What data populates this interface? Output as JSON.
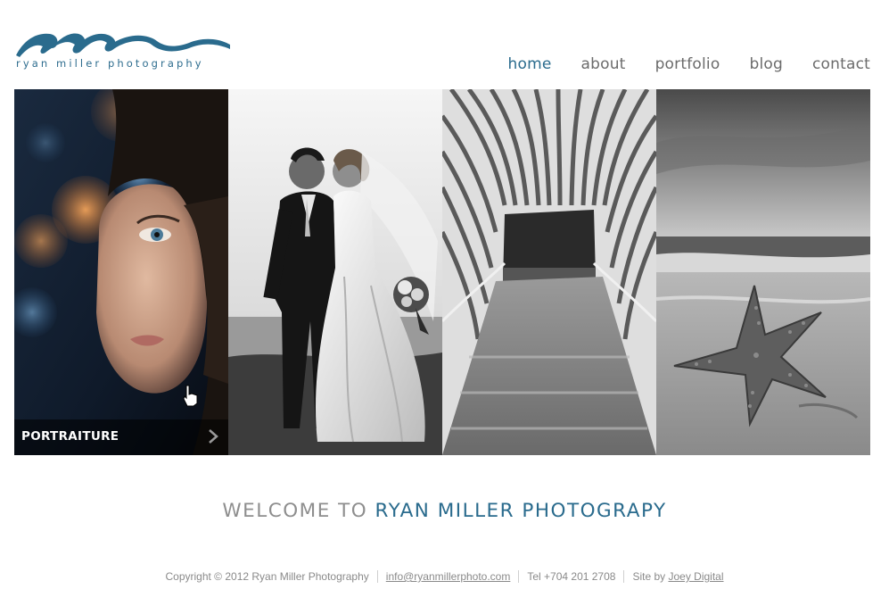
{
  "brand": {
    "name": "ryan miller photography",
    "accent_color": "#2a6b8d"
  },
  "nav": {
    "items": [
      {
        "label": "home",
        "active": true
      },
      {
        "label": "about",
        "active": false
      },
      {
        "label": "portfolio",
        "active": false
      },
      {
        "label": "blog",
        "active": false
      },
      {
        "label": "contact",
        "active": false
      }
    ]
  },
  "gallery": {
    "panels": [
      {
        "subject": "portrait of woman with bokeh lights",
        "caption": "PORTRAITURE",
        "icon": "chevron-right-icon"
      },
      {
        "subject": "wedding couple kissing on beach",
        "caption": ""
      },
      {
        "subject": "architecture curved walkway",
        "caption": ""
      },
      {
        "subject": "starfish on beach",
        "caption": ""
      }
    ]
  },
  "welcome": {
    "part1": "WELCOME TO",
    "part2": "RYAN MILLER PHOTOGRAPY"
  },
  "footer": {
    "copyright": "Copyright © 2012 Ryan Miller Photography",
    "email": "info@ryanmillerphoto.com",
    "phone": "Tel +704 201 2708",
    "site_by_prefix": "Site by",
    "site_by_link": "Joey Digital"
  }
}
